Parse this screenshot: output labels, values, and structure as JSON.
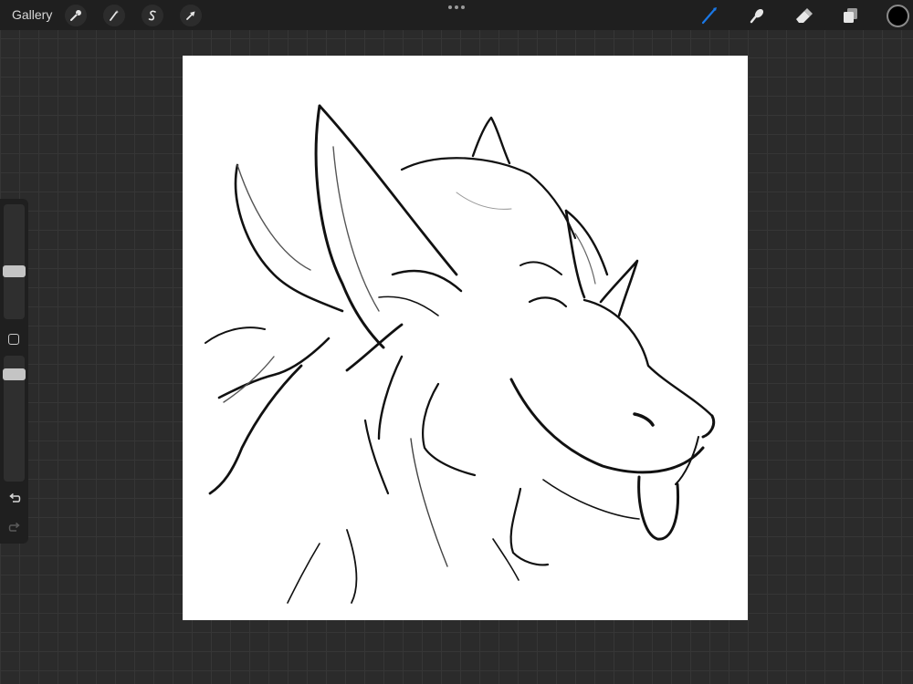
{
  "toolbar": {
    "gallery_label": "Gallery",
    "left_tools": [
      {
        "name": "actions",
        "icon": "wrench-icon"
      },
      {
        "name": "adjustments",
        "icon": "magic-wand-icon"
      },
      {
        "name": "selection",
        "icon": "selection-s-icon"
      },
      {
        "name": "transform",
        "icon": "arrow-cursor-icon"
      }
    ],
    "right_tools": [
      {
        "name": "brush",
        "icon": "brush-icon",
        "active": true
      },
      {
        "name": "smudge",
        "icon": "smudge-finger-icon",
        "active": false
      },
      {
        "name": "eraser",
        "icon": "eraser-icon",
        "active": false
      },
      {
        "name": "layers",
        "icon": "layers-icon",
        "active": false
      }
    ],
    "current_color": "#000000",
    "active_tool_color": "#1a78e6"
  },
  "sidebar": {
    "brush_size_level": 0.3,
    "opacity_level": 0.88,
    "modify_icon": "square-icon",
    "undo_icon": "undo-arrow-icon",
    "redo_icon": "redo-arrow-icon"
  },
  "canvas": {
    "background": "#ffffff",
    "content": "line-art-sketch"
  }
}
